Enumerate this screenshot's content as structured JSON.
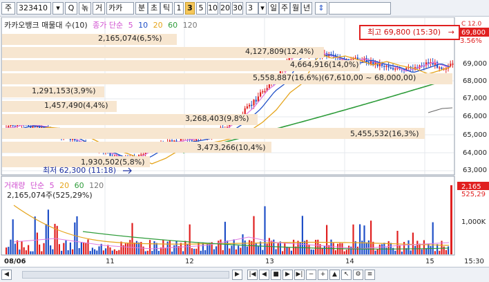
{
  "toolbar": {
    "market_select": "주",
    "code_input": "323410",
    "btn_search": "Q",
    "btn_filter": "녺",
    "btn_fn": "거",
    "stock_name": "카카",
    "period": [
      "분",
      "초",
      "틱"
    ],
    "intervals": [
      "1",
      "3",
      "5",
      "10",
      "20",
      "30"
    ],
    "selected_interval": "3",
    "count": "3",
    "views": [
      "일",
      "주",
      "월",
      "년"
    ],
    "sort_icon": "⇕"
  },
  "price_header": {
    "name": "카카오뱅크 매물대 수(10)",
    "ma_title": "종가 단순",
    "ma": [
      "5",
      "10",
      "20",
      "60",
      "120"
    ]
  },
  "high_box": {
    "label": "최고 69,800 (15:30)",
    "arrow": "→"
  },
  "right_labels": {
    "current": "69,800",
    "pct": "3.56%",
    "top": "C 12.0"
  },
  "volume_profile": [
    {
      "text": "2,165,074(6,5%)"
    },
    {
      "text": "4,127,809(12,4%)"
    },
    {
      "text": "4,664,916(14,0%)"
    },
    {
      "text": "5,558,887(16,6%)(67,610,00 ~ 68,000,00)"
    },
    {
      "text": "1,291,153(3,9%)"
    },
    {
      "text": "1,457,490(4,4%)"
    },
    {
      "text": "3,268,403(9,8%)"
    },
    {
      "text": "5,455,532(16,3%)"
    },
    {
      "text": "3,473,266(10,4%)"
    },
    {
      "text": "1,930,502(5,8%)"
    }
  ],
  "low_label": "최저 62,300 (11:18)",
  "y_axis": [
    "69,000",
    "68,000",
    "67,000",
    "66,000",
    "65,000",
    "64,000",
    "63,000"
  ],
  "volume_header": {
    "title": "거래량",
    "ma_title": "단순",
    "ma": [
      "5",
      "20",
      "60",
      "120"
    ],
    "sub": "2,165,074주(525,29%)"
  },
  "volume_right": {
    "vol_badge": "2,165",
    "pct": "525,29",
    "tick": "1,000K"
  },
  "x_axis": {
    "labels": [
      "08/06",
      "11",
      "12",
      "13",
      "14",
      "15"
    ],
    "last": "15:30"
  },
  "bottom": {
    "nav": [
      "◀",
      "▶"
    ],
    "controls": [
      "|◀",
      "◀",
      "■",
      "▶",
      "▶|",
      "−",
      "+",
      "▲",
      "↖",
      "⚙",
      "≡"
    ]
  },
  "colors": {
    "up": "#e02020",
    "down": "#1f4fc7",
    "ma5": "#e07be0",
    "ma10": "#1f4fc7",
    "ma20": "#e5a41a",
    "ma60": "#2e9c3a",
    "band": "#f7e6d0"
  }
}
